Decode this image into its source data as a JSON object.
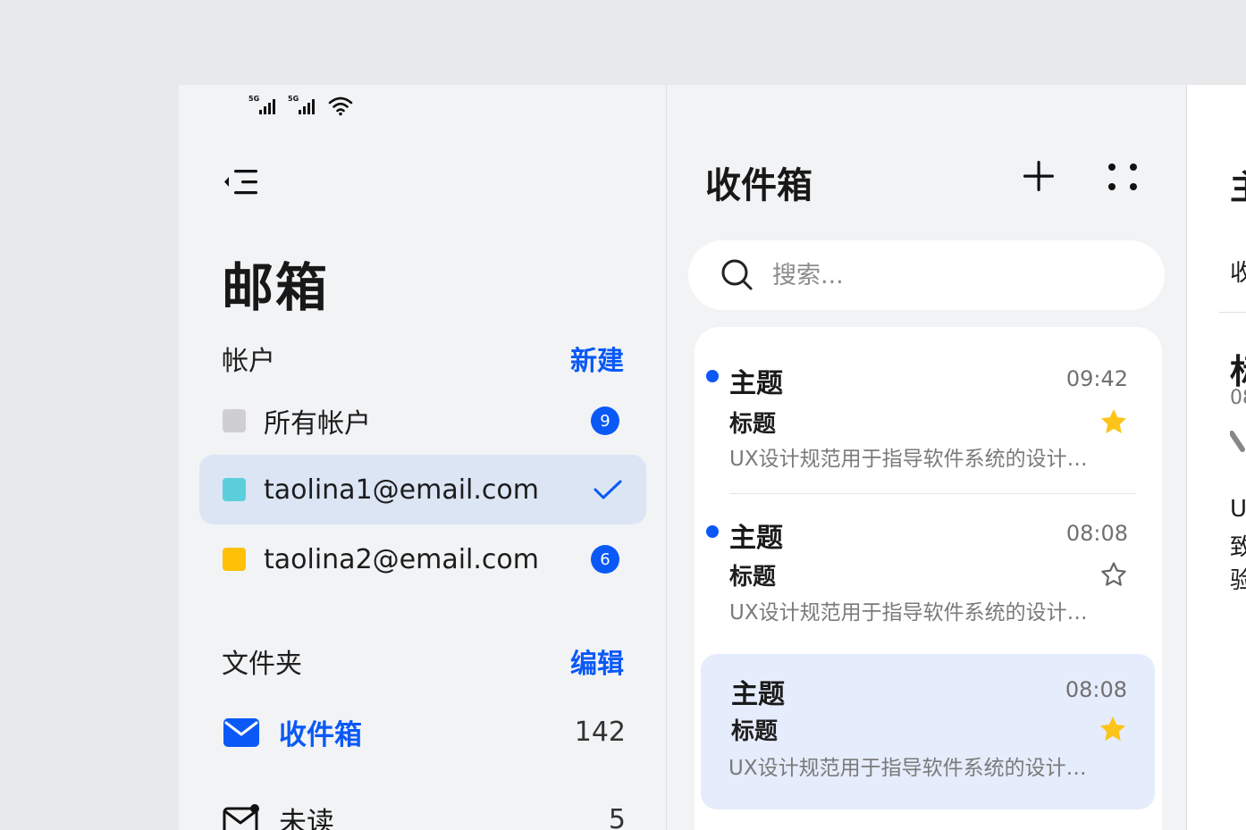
{
  "status_bar": {
    "signal1_label": "5G",
    "signal2_label": "5G"
  },
  "sidebar": {
    "title": "邮箱",
    "accounts_label": "帐户",
    "accounts_action": "新建",
    "accounts": [
      {
        "name": "所有帐户",
        "color": "#cfcfd1",
        "badge": "9",
        "selected": false
      },
      {
        "name": "taolina1@email.com",
        "color": "#5ccfdc",
        "badge": "",
        "selected": true
      },
      {
        "name": "taolina2@email.com",
        "color": "#ffc107",
        "badge": "6",
        "selected": false
      }
    ],
    "folders_label": "文件夹",
    "folders_action": "编辑",
    "folders": [
      {
        "name": "收件箱",
        "count": "142",
        "active": true
      },
      {
        "name": "未读",
        "count": "5",
        "active": false
      }
    ]
  },
  "inbox": {
    "title": "收件箱",
    "search": {
      "placeholder": "搜索..."
    },
    "mails": [
      {
        "subject": "主题",
        "time": "09:42",
        "title": "标题",
        "preview": "UX设计规范用于指导软件系统的设计…",
        "unread": true,
        "starred": true
      },
      {
        "subject": "主题",
        "time": "08:08",
        "title": "标题",
        "preview": "UX设计规范用于指导软件系统的设计…",
        "unread": true,
        "starred": false
      },
      {
        "subject": "主题",
        "time": "08:08",
        "title": "标题",
        "preview": "UX设计规范用于指导软件系统的设计…",
        "unread": false,
        "starred": true
      }
    ]
  },
  "detail_fragments": {
    "frag1": "主",
    "frag2": "收",
    "frag3": "标",
    "frag4": "08",
    "frag5": "U",
    "frag6": "致",
    "frag7": "验"
  },
  "colors": {
    "accent": "#0a59f7",
    "star": "#fcc419",
    "selected_bg": "#dbe5f4"
  }
}
